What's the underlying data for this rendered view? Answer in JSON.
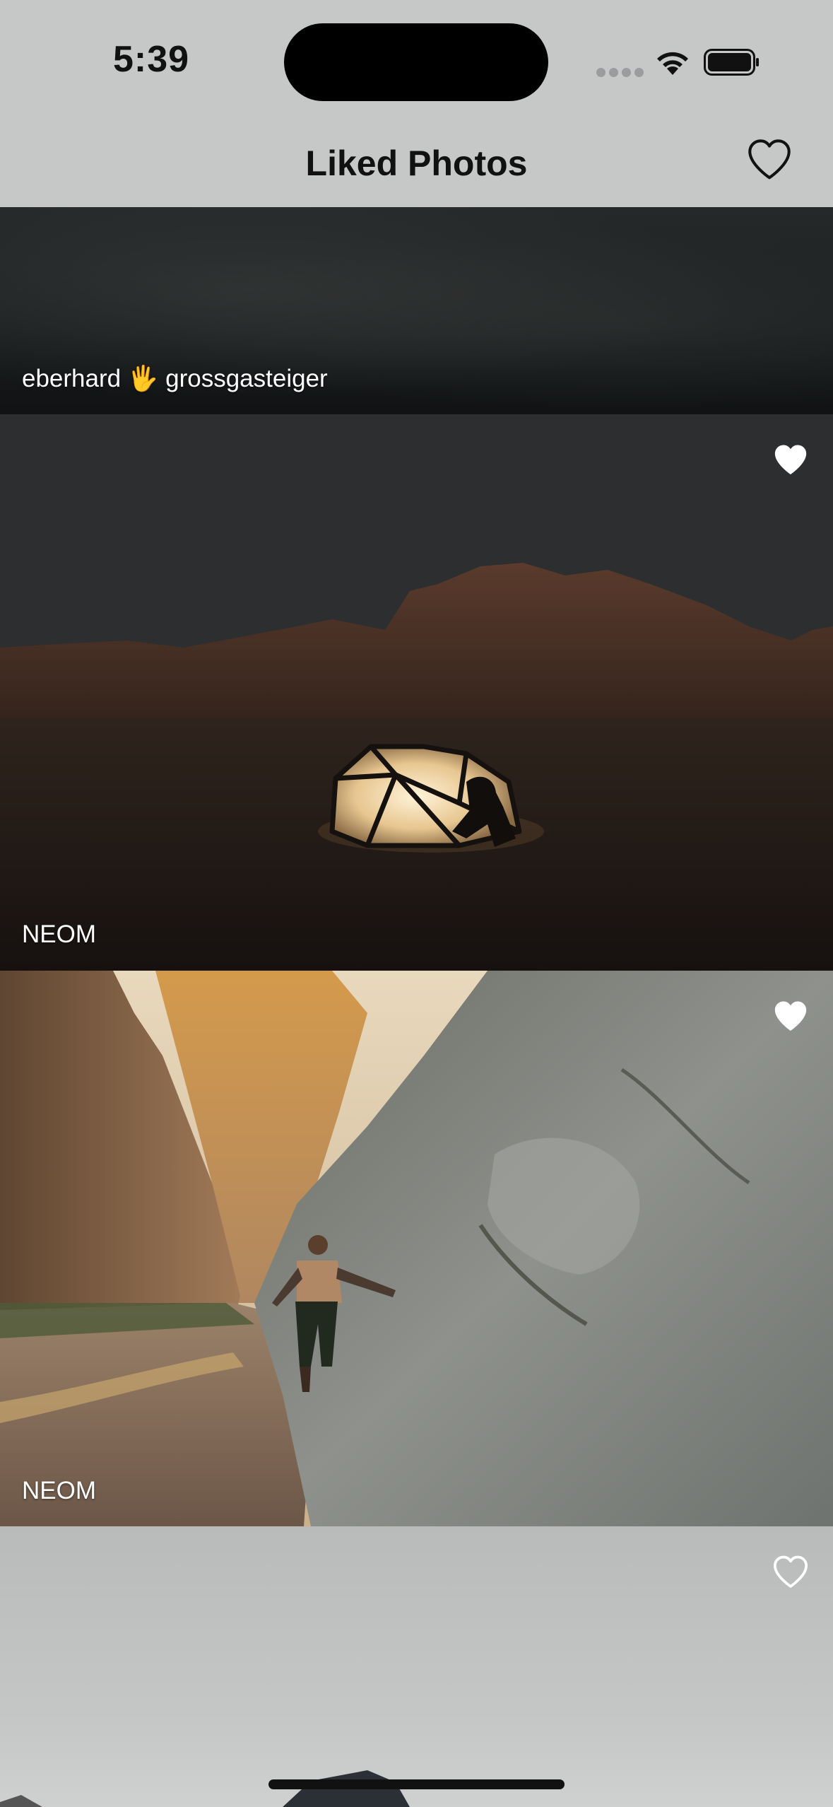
{
  "status_bar": {
    "time": "5:39"
  },
  "nav": {
    "title": "Liked Photos",
    "heart_icon": "heart-outline-icon"
  },
  "photos": [
    {
      "caption": "eberhard 🖐 grossgasteiger",
      "liked": true
    },
    {
      "caption": "NEOM",
      "liked": true
    },
    {
      "caption": "NEOM",
      "liked": true
    },
    {
      "caption": "",
      "liked": false
    }
  ],
  "colors": {
    "status_text": "#111111",
    "caption": "#ffffff",
    "heart_filled": "#ffffff"
  }
}
